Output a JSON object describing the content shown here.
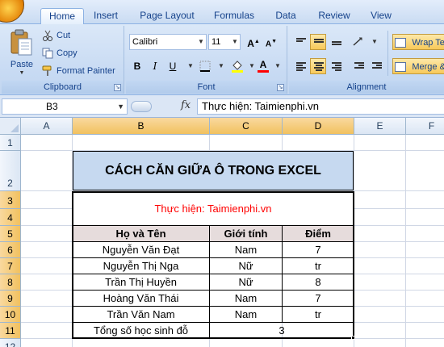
{
  "ribbon": {
    "tabs": [
      "Home",
      "Insert",
      "Page Layout",
      "Formulas",
      "Data",
      "Review",
      "View"
    ],
    "active_tab": "Home",
    "clipboard": {
      "paste_label": "Paste",
      "cut_label": "Cut",
      "copy_label": "Copy",
      "format_painter_label": "Format Painter",
      "group_label": "Clipboard"
    },
    "font": {
      "font_name": "Calibri",
      "font_size": "11",
      "grow_label": "A",
      "shrink_label": "A",
      "bold_label": "B",
      "italic_label": "I",
      "underline_label": "U",
      "font_color_label": "A",
      "group_label": "Font"
    },
    "alignment": {
      "wrap_text_label": "Wrap Te",
      "merge_label": "Merge &",
      "group_label": "Alignment"
    }
  },
  "formula_bar": {
    "name_box": "B3",
    "fx_label": "fx",
    "formula": "Thực hiện: Taimienphi.vn"
  },
  "grid": {
    "columns": [
      "A",
      "B",
      "C",
      "D",
      "E",
      "F"
    ],
    "selected_columns": [
      "B",
      "C",
      "D"
    ],
    "rows": [
      "1",
      "2",
      "3",
      "4",
      "5",
      "6",
      "7",
      "8",
      "9",
      "10",
      "11",
      "12"
    ],
    "selected_rows": [
      "3",
      "4",
      "5",
      "6",
      "7",
      "8",
      "9",
      "10",
      "11"
    ]
  },
  "sheet": {
    "title": "CÁCH CĂN GIỮA Ô TRONG EXCEL",
    "author": "Thực hiện: Taimienphi.vn",
    "headers": [
      "Họ và Tên",
      "Giới tính",
      "Điểm"
    ],
    "rows": [
      [
        "Nguyễn Văn Đạt",
        "Nam",
        "7"
      ],
      [
        "Nguyễn Thị Nga",
        "Nữ",
        "tr"
      ],
      [
        "Trần Thị Huyền",
        "Nữ",
        "8"
      ],
      [
        "Hoàng Văn Thái",
        "Nam",
        "7"
      ],
      [
        "Trần Văn Nam",
        "Nam",
        "tr"
      ]
    ],
    "total_label": "Tổng số học sinh đỗ",
    "total_value": "3"
  },
  "colors": {
    "title_fill": "#c6d9f0",
    "header_fill": "#e6dcdc",
    "author_text": "#ff0000",
    "selected_header": "#f1c15f"
  }
}
